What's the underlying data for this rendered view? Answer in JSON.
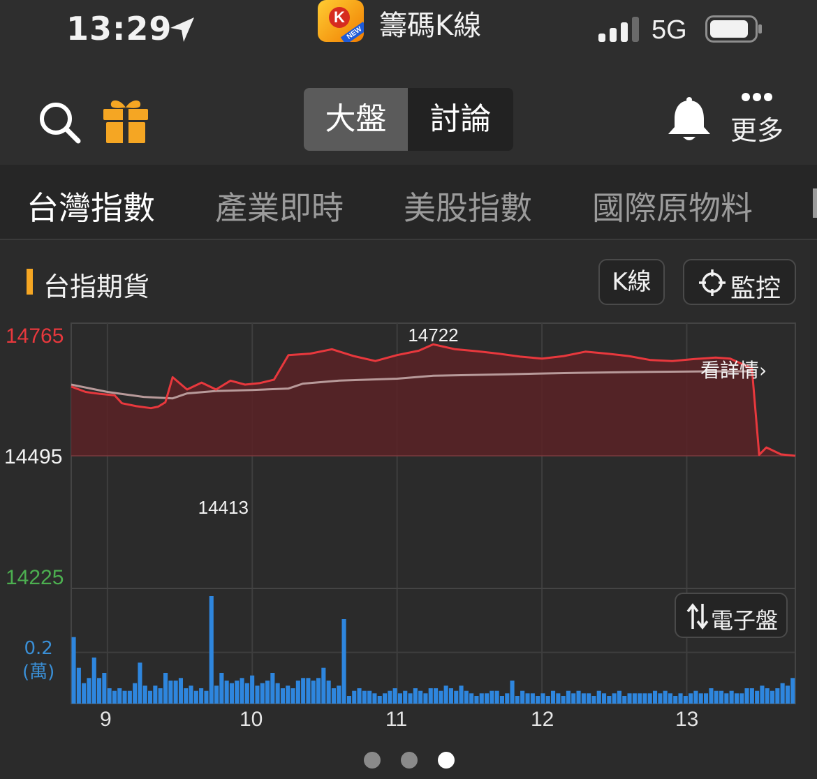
{
  "status_bar": {
    "time": "13:29",
    "app_name": "籌碼K線",
    "app_icon_letter": "K",
    "app_icon_badge": "NEW",
    "network": "5G"
  },
  "header": {
    "segments": [
      {
        "label": "大盤",
        "selected": true
      },
      {
        "label": "討論",
        "selected": false
      }
    ],
    "more_label": "更多",
    "icons": [
      "search-icon",
      "gift-icon",
      "bell-icon",
      "more-dots-icon"
    ],
    "gift_color": "#f5a623"
  },
  "categories": [
    {
      "label": "台灣指數",
      "active": true
    },
    {
      "label": "產業即時",
      "active": false
    },
    {
      "label": "美股指數",
      "active": false
    },
    {
      "label": "國際原物料",
      "active": false
    }
  ],
  "section": {
    "title": "台指期貨",
    "kline_button": "K線",
    "monitor_button": "監控",
    "detail_link": "看詳情",
    "electronic_button": "電子盤",
    "accent": "#f5a623"
  },
  "chart_data": {
    "type": "line",
    "x_ticks": [
      "9",
      "10",
      "11",
      "12",
      "13"
    ],
    "y_ticks": [
      {
        "label": "14765",
        "value": 14765,
        "color": "#e8383d"
      },
      {
        "label": "14495",
        "value": 14495,
        "color": "#f2f2f2"
      },
      {
        "label": "14225",
        "value": 14225,
        "color": "#4caf50"
      }
    ],
    "ylim": [
      14225,
      14765
    ],
    "reference": 14495,
    "high_label": "14722",
    "low_label": "14413",
    "xlim_hours": [
      8.75,
      13.75
    ],
    "series": [
      {
        "role": "price",
        "color": "#e8383d",
        "points": [
          [
            8.75,
            14636
          ],
          [
            8.85,
            14625
          ],
          [
            8.95,
            14621
          ],
          [
            9.05,
            14618
          ],
          [
            9.1,
            14602
          ],
          [
            9.2,
            14596
          ],
          [
            9.3,
            14592
          ],
          [
            9.35,
            14595
          ],
          [
            9.4,
            14604
          ],
          [
            9.45,
            14655
          ],
          [
            9.55,
            14630
          ],
          [
            9.65,
            14644
          ],
          [
            9.75,
            14630
          ],
          [
            9.85,
            14648
          ],
          [
            9.95,
            14640
          ],
          [
            10.05,
            14643
          ],
          [
            10.15,
            14650
          ],
          [
            10.25,
            14700
          ],
          [
            10.4,
            14703
          ],
          [
            10.55,
            14712
          ],
          [
            10.7,
            14698
          ],
          [
            10.85,
            14688
          ],
          [
            11.0,
            14700
          ],
          [
            11.15,
            14709
          ],
          [
            11.25,
            14722
          ],
          [
            11.4,
            14712
          ],
          [
            11.55,
            14708
          ],
          [
            11.7,
            14703
          ],
          [
            11.85,
            14697
          ],
          [
            12.0,
            14693
          ],
          [
            12.15,
            14698
          ],
          [
            12.3,
            14707
          ],
          [
            12.45,
            14703
          ],
          [
            12.6,
            14698
          ],
          [
            12.75,
            14690
          ],
          [
            12.9,
            14688
          ],
          [
            13.05,
            14692
          ],
          [
            13.2,
            14695
          ],
          [
            13.3,
            14693
          ],
          [
            13.45,
            14673
          ],
          [
            13.5,
            14497
          ],
          [
            13.55,
            14512
          ],
          [
            13.65,
            14498
          ],
          [
            13.75,
            14495
          ]
        ]
      },
      {
        "role": "average",
        "color": "#b89a9a",
        "points": [
          [
            8.75,
            14640
          ],
          [
            9.0,
            14625
          ],
          [
            9.25,
            14615
          ],
          [
            9.45,
            14612
          ],
          [
            9.55,
            14622
          ],
          [
            9.75,
            14627
          ],
          [
            10.0,
            14629
          ],
          [
            10.25,
            14632
          ],
          [
            10.35,
            14642
          ],
          [
            10.6,
            14648
          ],
          [
            11.0,
            14652
          ],
          [
            11.25,
            14658
          ],
          [
            11.75,
            14661
          ],
          [
            12.25,
            14664
          ],
          [
            12.75,
            14666
          ],
          [
            13.2,
            14667
          ],
          [
            13.45,
            14667
          ]
        ]
      }
    ],
    "volume": {
      "color": "#2e86de",
      "axis_label": "0.2",
      "axis_unit": "(萬)",
      "axis_value": 0.2,
      "max": 0.45,
      "values": [
        0.26,
        0.14,
        0.08,
        0.1,
        0.09,
        0.1,
        0.12,
        0.06,
        0.05,
        0.06,
        0.05,
        0.05,
        0.08,
        0.1,
        0.07,
        0.05,
        0.07,
        0.06,
        0.12,
        0.09,
        0.09,
        0.1,
        0.06,
        0.07,
        0.05,
        0.06,
        0.05,
        0.05,
        0.07,
        0.12,
        0.09,
        0.08,
        0.09,
        0.1,
        0.08,
        0.11,
        0.07,
        0.08,
        0.09,
        0.12,
        0.08,
        0.06,
        0.07,
        0.06,
        0.09,
        0.1,
        0.1,
        0.09,
        0.1,
        0.14,
        0.09,
        0.06,
        0.07,
        0.04,
        0.03,
        0.05,
        0.06,
        0.05,
        0.05,
        0.04,
        0.03,
        0.04,
        0.05,
        0.06,
        0.04,
        0.05,
        0.04,
        0.06,
        0.05,
        0.04,
        0.06,
        0.06,
        0.05,
        0.07,
        0.06,
        0.05,
        0.07,
        0.05,
        0.04,
        0.03,
        0.04,
        0.04,
        0.05,
        0.05,
        0.03,
        0.04,
        0.04,
        0.03,
        0.05,
        0.04,
        0.04,
        0.03,
        0.04,
        0.03,
        0.05,
        0.04,
        0.03,
        0.05,
        0.04,
        0.05,
        0.04,
        0.04,
        0.03,
        0.05,
        0.04,
        0.03,
        0.04,
        0.05,
        0.03,
        0.04,
        0.04,
        0.04,
        0.04,
        0.04,
        0.05,
        0.04,
        0.05,
        0.04,
        0.03,
        0.04,
        0.03,
        0.04,
        0.05,
        0.04,
        0.04,
        0.06,
        0.05,
        0.05,
        0.04,
        0.05,
        0.04,
        0.04,
        0.06,
        0.06,
        0.05,
        0.07,
        0.06,
        0.05,
        0.06,
        0.08,
        0.07,
        0.1
      ],
      "spikes": [
        {
          "index": 4,
          "value": 0.18
        },
        {
          "index": 13,
          "value": 0.16
        },
        {
          "index": 27,
          "value": 0.42
        },
        {
          "index": 53,
          "value": 0.33
        },
        {
          "index": 86,
          "value": 0.09
        }
      ]
    },
    "page_indicator": {
      "count": 3,
      "active": 2
    }
  }
}
